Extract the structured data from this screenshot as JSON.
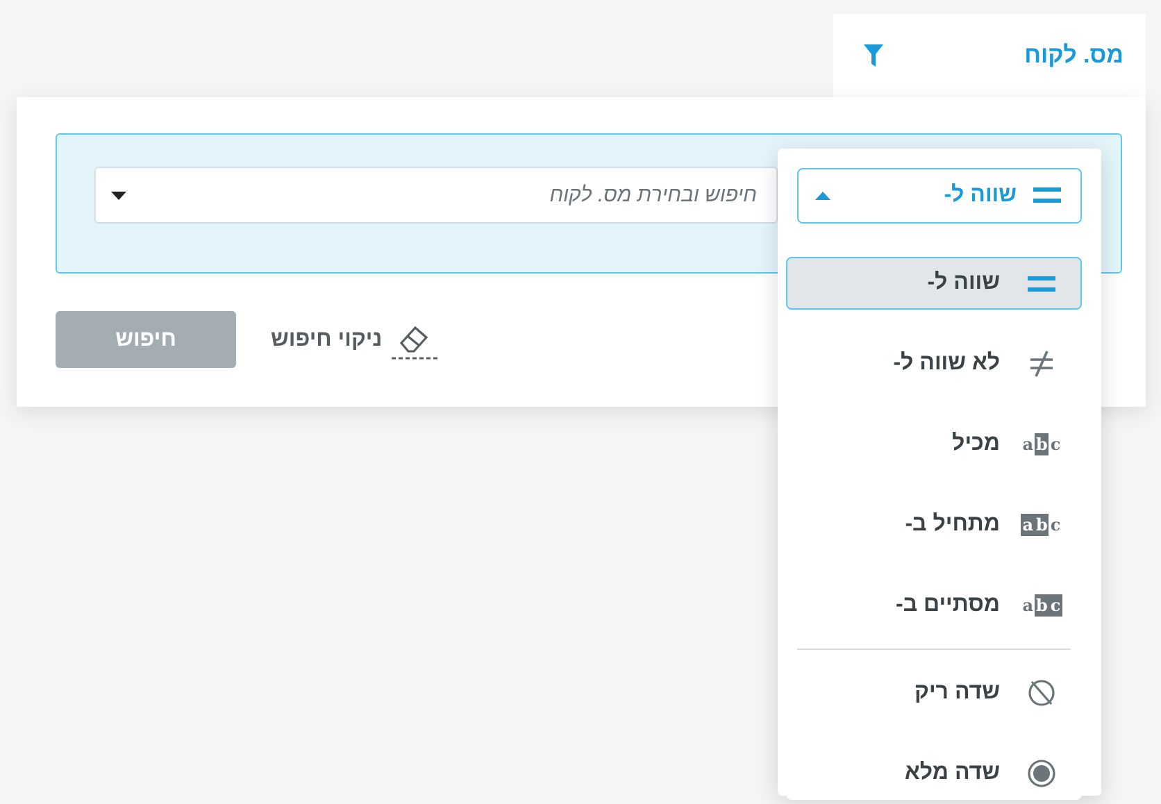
{
  "filter_tab": {
    "label": "מס. לקוח"
  },
  "search_field": {
    "placeholder": "חיפוש ובחירת מס. לקוח"
  },
  "clear_button": {
    "label": "ניקוי חיפוש"
  },
  "search_button": {
    "label": "חיפוש",
    "disabled": true
  },
  "operator_select": {
    "value": "שווה ל-",
    "expanded": true
  },
  "operators": [
    {
      "kind": "equals",
      "label": "שווה ל-",
      "selected": true,
      "divider_before": false
    },
    {
      "kind": "not_equals",
      "label": "לא שווה ל-",
      "selected": false,
      "divider_before": false
    },
    {
      "kind": "contains",
      "label": "מכיל",
      "icon_text": "abc",
      "selected": false,
      "divider_before": false
    },
    {
      "kind": "starts_with",
      "label": "מתחיל ב-",
      "icon_text": "abc",
      "selected": false,
      "divider_before": false
    },
    {
      "kind": "ends_with",
      "label": "מסתיים ב-",
      "icon_text": "abc",
      "selected": false,
      "divider_before": false
    },
    {
      "kind": "empty",
      "label": "שדה ריק",
      "selected": false,
      "divider_before": true
    },
    {
      "kind": "filled",
      "label": "שדה מלא",
      "selected": false,
      "divider_before": false
    }
  ]
}
